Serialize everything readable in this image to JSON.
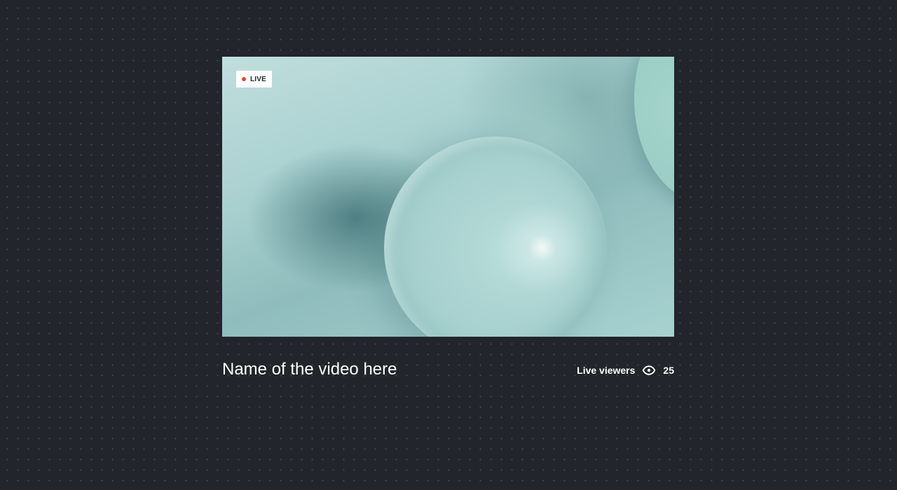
{
  "player": {
    "live_label": "LIVE",
    "live_color": "#e2492b"
  },
  "video": {
    "title": "Name of the video here"
  },
  "stats": {
    "viewers_label": "Live viewers",
    "viewers_icon": "eye-icon",
    "viewers_count": "25"
  }
}
